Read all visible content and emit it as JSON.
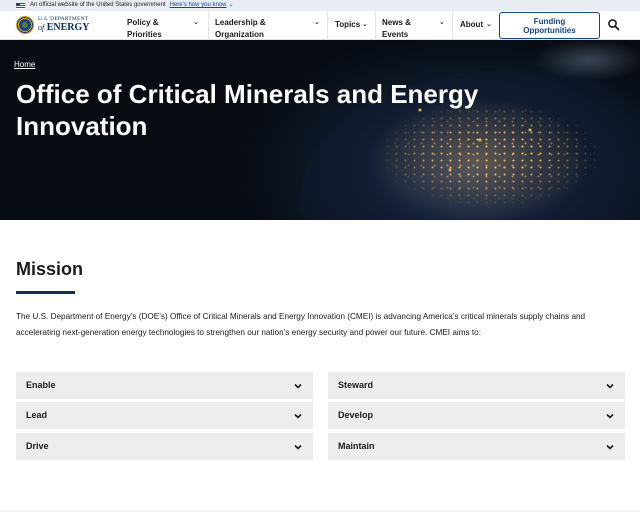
{
  "banner": {
    "text": "An official website of the United States government",
    "link": "Here's how you know"
  },
  "header": {
    "logo_top": "U.S. DEPARTMENT",
    "logo_bottom_prefix": "of",
    "logo_bottom": "ENERGY",
    "nav": [
      {
        "label_line1": "Policy &",
        "label_line2": "Priorities"
      },
      {
        "label_line1": "Leadership &",
        "label_line2": "Organization"
      },
      {
        "label_line1": "Topics",
        "label_line2": ""
      },
      {
        "label_line1": "News &",
        "label_line2": "Events"
      },
      {
        "label_line1": "About",
        "label_line2": ""
      }
    ],
    "funding_line1": "Funding",
    "funding_line2": "Opportunities"
  },
  "hero": {
    "breadcrumb": "Home",
    "title": "Office of Critical Minerals and Energy Innovation"
  },
  "mission": {
    "title": "Mission",
    "text": "The U.S. Department of Energy’s (DOE’s) Office of Critical Minerals and Energy Innovation (CMEI) is advancing America’s critical minerals supply chains and accelerating next-generation energy technologies to strengthen our nation’s energy security and power our future. CMEI aims to:",
    "accordions_left": [
      "Enable",
      "Lead",
      "Drive"
    ],
    "accordions_right": [
      "Steward",
      "Develop",
      "Maintain"
    ]
  }
}
